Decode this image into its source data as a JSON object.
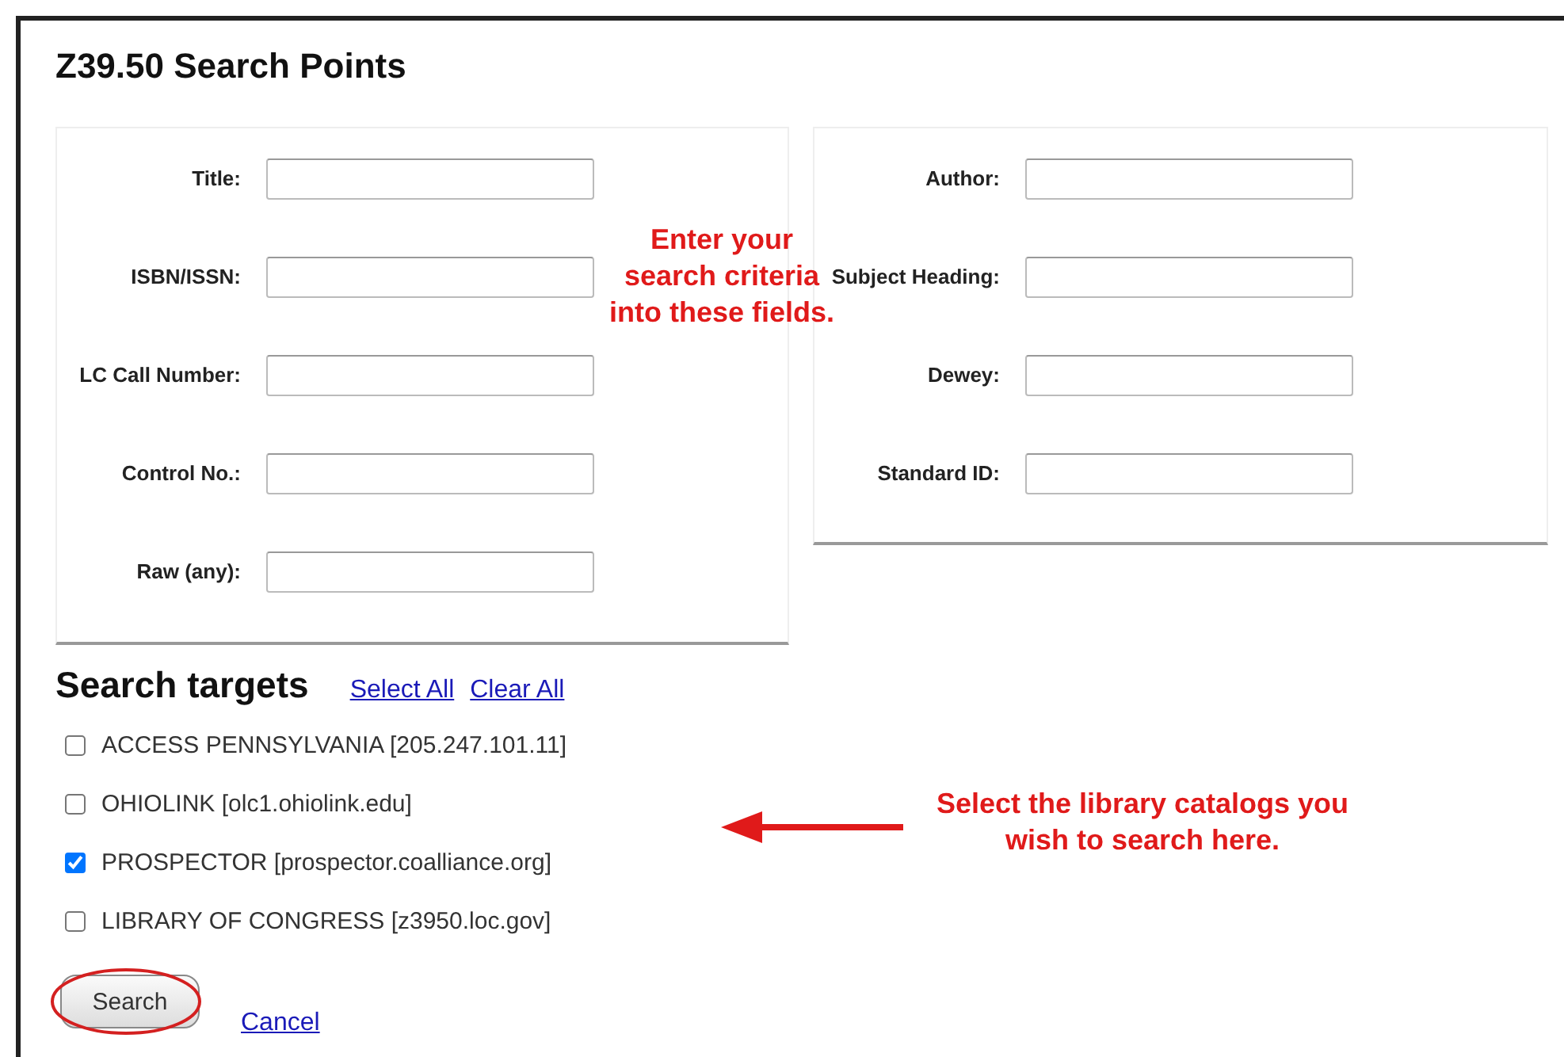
{
  "title": "Z39.50 Search Points",
  "left_fields": [
    {
      "label": "Title:"
    },
    {
      "label": "ISBN/ISSN:"
    },
    {
      "label": "LC Call Number:"
    },
    {
      "label": "Control No.:"
    },
    {
      "label": "Raw (any):"
    }
  ],
  "right_fields": [
    {
      "label": "Author:"
    },
    {
      "label": "Subject Heading:"
    },
    {
      "label": "Dewey:"
    },
    {
      "label": "Standard ID:"
    }
  ],
  "fields_note": "Enter your search criteria into these fields.",
  "targets_heading": "Search targets",
  "target_links": [
    "Select All",
    "Clear All"
  ],
  "targets": [
    {
      "label": "ACCESS PENNSYLVANIA [205.247.101.11]",
      "checked": false
    },
    {
      "label": "OHIOLINK [olc1.ohiolink.edu]",
      "checked": false
    },
    {
      "label": "PROSPECTOR [prospector.coalliance.org]",
      "checked": true
    },
    {
      "label": "LIBRARY OF CONGRESS [z3950.loc.gov]",
      "checked": false
    }
  ],
  "targets_note": "Select the library catalogs you wish to search here.",
  "search_button": "Search",
  "cancel_link": "Cancel"
}
